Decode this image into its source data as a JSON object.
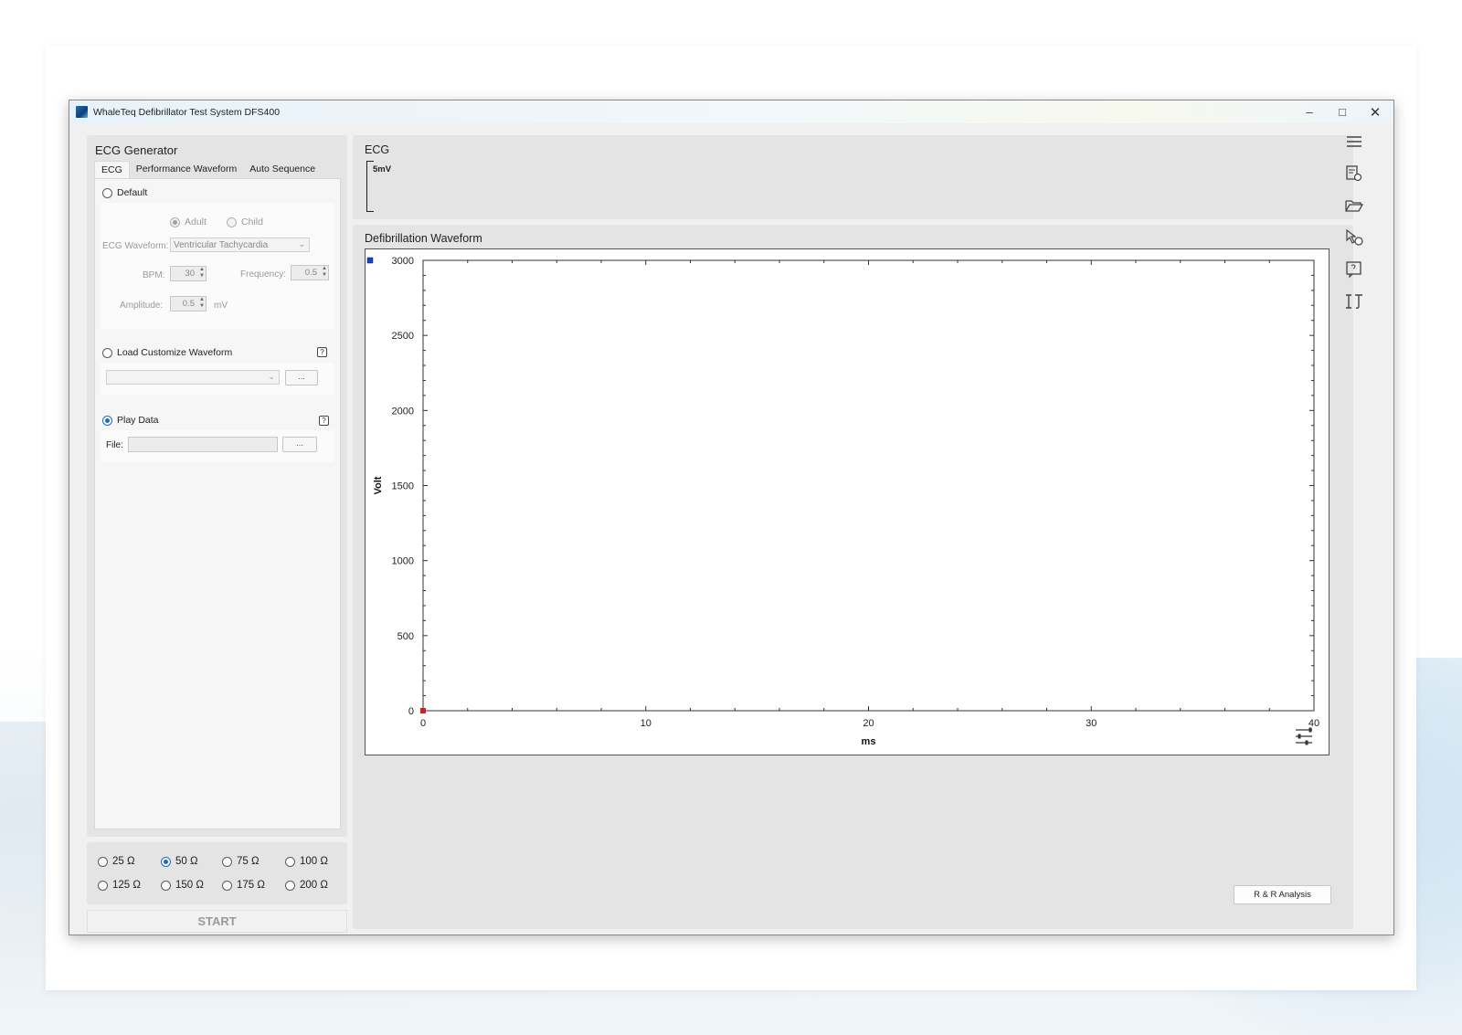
{
  "window": {
    "title": "WhaleTeq Defibrillator Test System DFS400",
    "controls": {
      "minimize": "–",
      "maximize": "□",
      "close": "✕"
    }
  },
  "ecg_generator": {
    "heading": "ECG Generator",
    "tabs": [
      {
        "label": "ECG",
        "active": true
      },
      {
        "label": "Performance Waveform",
        "active": false
      },
      {
        "label": "Auto Sequence",
        "active": false
      }
    ],
    "default": {
      "label": "Default",
      "selected": false,
      "patient": {
        "adult": "Adult",
        "child": "Child",
        "selected": "Adult"
      },
      "waveform_label": "ECG Waveform:",
      "waveform_value": "Ventricular Tachycardia",
      "bpm_label": "BPM:",
      "bpm_value": "30",
      "frequency_label": "Frequency:",
      "frequency_value": "0.5",
      "amplitude_label": "Amplitude:",
      "amplitude_value": "0.5",
      "amplitude_unit": "mV"
    },
    "load_custom": {
      "label": "Load Customize Waveform",
      "selected": false,
      "browse": "..."
    },
    "play_data": {
      "label": "Play Data",
      "selected": true,
      "file_label": "File:",
      "file_value": "",
      "browse": "..."
    }
  },
  "load_resistance": {
    "options": [
      "25 Ω",
      "50 Ω",
      "75 Ω",
      "100 Ω",
      "125 Ω",
      "150 Ω",
      "175 Ω",
      "200 Ω"
    ],
    "selected": "50 Ω"
  },
  "start_label": "START",
  "ecg_panel": {
    "title": "ECG",
    "scale_label": "5mV"
  },
  "defib_panel": {
    "title": "Defibrillation Waveform",
    "rr_button": "R & R Analysis"
  },
  "chart_data": {
    "type": "line",
    "title": "",
    "xlabel": "ms",
    "ylabel": "Volt",
    "xlim": [
      0,
      40
    ],
    "ylim": [
      0,
      3000
    ],
    "x_ticks": [
      0,
      10,
      20,
      30,
      40
    ],
    "y_ticks": [
      0,
      500,
      1000,
      1500,
      2000,
      2500,
      3000
    ],
    "grid": false,
    "series": [],
    "markers": [
      {
        "x": 0,
        "y": 0,
        "color": "#d02020"
      }
    ],
    "legend_marker_color": "#1f3fc4"
  },
  "sidebar_icons": [
    "menu-icon",
    "report-settings-icon",
    "open-folder-icon",
    "cursor-settings-icon",
    "help-document-icon",
    "measurement-icon"
  ]
}
